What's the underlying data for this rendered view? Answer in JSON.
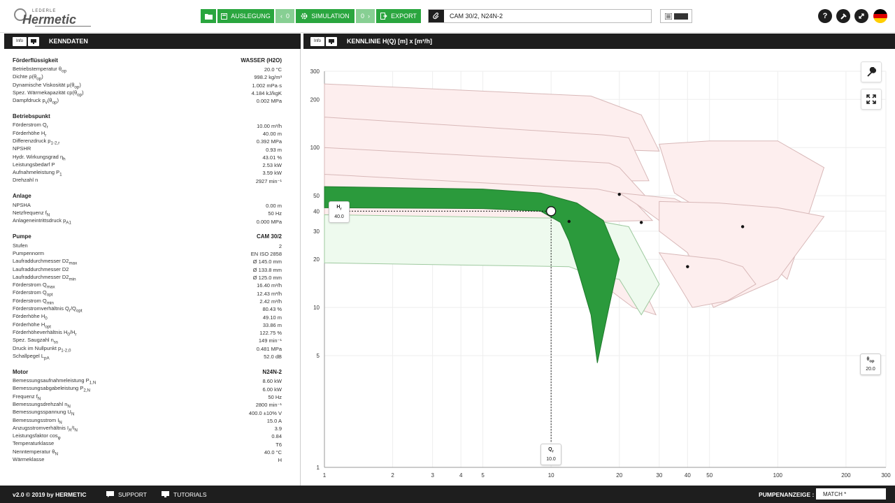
{
  "header": {
    "logo_small": "LEDERLE",
    "logo_big": "Hermetic",
    "folder_icon": "folder-icon",
    "btn_auslegung": "AUSLEGUNG",
    "btn_auslegung_count": "0",
    "btn_simulation": "SIMULATION",
    "btn_simulation_count": "0",
    "btn_export": "EXPORT",
    "project_name": "CAM 30/2, N24N-2",
    "help": "?",
    "flag_colors": [
      "#000000",
      "#dd0000",
      "#ffce00"
    ]
  },
  "left_panel": {
    "chip_info": "Info",
    "title": "KENNDATEN",
    "sections": [
      {
        "title": "Förderflüssigkeit",
        "value": "WASSER (H2O)",
        "rows": [
          [
            "Betriebstemperatur θ",
            "op",
            "20.0 °C"
          ],
          [
            "Dichte ρ(θ",
            "op",
            ")",
            "998.2 kg/m³"
          ],
          [
            "Dynamische Viskosität μ(θ",
            "op",
            ")",
            "1.002 mPa·s"
          ],
          [
            "Spez. Wärmekapazität cp(θ",
            "op",
            ")",
            "4.184 kJ/kgK"
          ],
          [
            "Dampfdruck p",
            "v",
            "(θ",
            "op",
            ")",
            "0.002 MPa"
          ]
        ]
      },
      {
        "title": "Betriebspunkt",
        "value": "",
        "rows": [
          [
            "Förderstrom Q",
            "r",
            "10.00 m³/h"
          ],
          [
            "Förderhöhe H",
            "r",
            "40.00 m"
          ],
          [
            "Differenzdruck p",
            "1-2,r",
            "0.392 MPa"
          ],
          [
            "NPSHR",
            "",
            "0.93 m"
          ],
          [
            "Hydr. Wirkungsgrad η",
            "h",
            "43.01 %"
          ],
          [
            "Leistungsbedarf P",
            "",
            "2.53 kW"
          ],
          [
            "Aufnahmeleistung P",
            "1",
            "3.59 kW"
          ],
          [
            "Drehzahl n",
            "",
            "2927 min⁻¹"
          ]
        ]
      },
      {
        "title": "Anlage",
        "value": "",
        "rows": [
          [
            "NPSHA",
            "",
            "0.00 m"
          ],
          [
            "Netzfrequenz f",
            "N",
            "50 Hz"
          ],
          [
            "Anlageneintrittsdruck p",
            "A1",
            "0.000 MPa"
          ]
        ]
      },
      {
        "title": "Pumpe",
        "value": "CAM 30/2",
        "rows": [
          [
            "Stufen",
            "",
            "2"
          ],
          [
            "Pumpennorm",
            "",
            "EN ISO 2858"
          ],
          [
            "Laufraddurchmesser D2",
            "max",
            "Ø 145.0 mm"
          ],
          [
            "Laufraddurchmesser D2",
            "",
            "Ø 133.8 mm"
          ],
          [
            "Laufraddurchmesser D2",
            "min",
            "Ø 125.0 mm"
          ],
          [
            "Förderstrom Q",
            "max",
            "16.40 m³/h"
          ],
          [
            "Förderstrom Q",
            "opt",
            "12.43 m³/h"
          ],
          [
            "Förderstrom Q",
            "min",
            "2.42 m³/h"
          ],
          [
            "Förderstromverhältnis Q",
            "r",
            "/Q",
            "opt",
            "80.43 %"
          ],
          [
            "Förderhöhe H",
            "0",
            "49.10 m"
          ],
          [
            "Förderhöhe H",
            "opt",
            "33.86 m"
          ],
          [
            "Förderhöheverhältnis H",
            "0",
            "/H",
            "r",
            "122.75 %"
          ],
          [
            "Spez. Saugzahl n",
            "ss",
            "149 min⁻¹"
          ],
          [
            "Druck im Nullpunkt p",
            "1-2,0",
            "0.481 MPa"
          ],
          [
            "Schallpegel L",
            "pA",
            "52.0 dB"
          ]
        ]
      },
      {
        "title": "Motor",
        "value": "N24N-2",
        "rows": [
          [
            "Bemessungsaufnahmeleistung P",
            "1,N",
            "8.60 kW"
          ],
          [
            "Bemessungsabgabeleistung P",
            "2,N",
            "6.00 kW"
          ],
          [
            "Frequenz f",
            "N",
            "50 Hz"
          ],
          [
            "Bemessungsdrehzahl n",
            "N",
            "2800 min⁻¹"
          ],
          [
            "Bemessungsspannung U",
            "N",
            "400.0 ±10% V"
          ],
          [
            "Bemessungsstrom I",
            "N",
            "15.0 A"
          ],
          [
            "Anzugsstromverhältnis I",
            "A",
            "/I",
            "N",
            "3.9"
          ],
          [
            "Leistungsfaktor cos",
            "φ",
            "0.84"
          ],
          [
            "Temperaturklasse",
            "",
            "T6"
          ],
          [
            "Nenntemperatur θ",
            "N",
            "40.0 °C"
          ],
          [
            "Wärmeklasse",
            "",
            "H"
          ]
        ]
      }
    ]
  },
  "chart_panel": {
    "chip_info": "Info",
    "title": "KENNLINIE H(Q) [m] x [m³/h]"
  },
  "chart_data": {
    "type": "area",
    "x_scale": "log",
    "y_scale": "log",
    "xlim": [
      1,
      300
    ],
    "ylim": [
      1,
      300
    ],
    "x_ticks": [
      1,
      2,
      3,
      4,
      5,
      10,
      20,
      30,
      40,
      50,
      100,
      200,
      300
    ],
    "y_ticks": [
      1,
      5,
      10,
      20,
      30,
      40,
      50,
      100,
      200,
      300
    ],
    "operating_point": {
      "x": 10.0,
      "y": 40.0
    },
    "tag_h": {
      "label": "H",
      "sub": "r",
      "value": "40.0"
    },
    "tag_q": {
      "label": "Q",
      "sub": "r",
      "value": "10.0"
    },
    "tag_theta": {
      "label": "θ",
      "sub": "op",
      "value": "20.0"
    },
    "colors": {
      "selected": "#2b9a3c",
      "selected_light": "#eefaee",
      "other": "#fdeeee",
      "other_stroke": "#d8b8b8"
    },
    "other_pumps": [
      {
        "name": "",
        "points": [
          [
            1,
            250
          ],
          [
            15,
            210
          ],
          [
            25,
            160
          ],
          [
            30,
            95
          ],
          [
            1,
            110
          ]
        ]
      },
      {
        "name": "",
        "points": [
          [
            1,
            155
          ],
          [
            17,
            120
          ],
          [
            22,
            115
          ],
          [
            27,
            62
          ],
          [
            1,
            60
          ]
        ]
      },
      {
        "name": "",
        "points": [
          [
            1,
            100
          ],
          [
            18,
            80
          ],
          [
            20,
            75
          ],
          [
            26,
            50
          ],
          [
            1,
            45
          ]
        ]
      },
      {
        "name": "",
        "points": [
          [
            1,
            68
          ],
          [
            16,
            55
          ],
          [
            22,
            50
          ],
          [
            28,
            35
          ],
          [
            1,
            32
          ]
        ]
      },
      {
        "name": "",
        "points": [
          [
            20,
            52
          ],
          [
            35,
            48
          ],
          [
            45,
            40
          ],
          [
            48,
            33
          ],
          [
            30,
            35
          ],
          [
            24,
            44
          ]
        ]
      },
      {
        "name": "",
        "points": [
          [
            30,
            105
          ],
          [
            50,
            110
          ],
          [
            100,
            110
          ],
          [
            160,
            75
          ],
          [
            110,
            15
          ],
          [
            60,
            32
          ],
          [
            35,
            52
          ]
        ]
      },
      {
        "name": "",
        "points": [
          [
            30,
            46
          ],
          [
            55,
            45
          ],
          [
            100,
            42
          ],
          [
            160,
            37
          ],
          [
            100,
            15
          ],
          [
            52,
            10
          ],
          [
            40,
            22
          ],
          [
            30,
            30
          ]
        ]
      },
      {
        "name": "",
        "points": [
          [
            30,
            22
          ],
          [
            55,
            20
          ],
          [
            70,
            18
          ],
          [
            80,
            14
          ],
          [
            60,
            11
          ],
          [
            42,
            10
          ]
        ]
      },
      {
        "name": "",
        "points": [
          [
            12,
            20
          ],
          [
            20,
            18
          ],
          [
            25,
            14
          ],
          [
            29,
            9
          ],
          [
            23,
            10
          ]
        ]
      }
    ],
    "selected_pump_lite": {
      "name": "",
      "points": [
        [
          1,
          38
        ],
        [
          14,
          36
        ],
        [
          22,
          32
        ],
        [
          30,
          14
        ],
        [
          25,
          9
        ],
        [
          20,
          15
        ],
        [
          15,
          16
        ],
        [
          12,
          18
        ],
        [
          1,
          19
        ]
      ]
    },
    "selected_pump_region": {
      "name": "",
      "points": [
        [
          1,
          57
        ],
        [
          5,
          55
        ],
        [
          9,
          52
        ],
        [
          13,
          45
        ],
        [
          17,
          35
        ],
        [
          20,
          20
        ],
        [
          18,
          10
        ],
        [
          16,
          4.5
        ],
        [
          15,
          9
        ],
        [
          13,
          18
        ],
        [
          12,
          26
        ],
        [
          11,
          34
        ],
        [
          9,
          40
        ],
        [
          5,
          41.5
        ],
        [
          1,
          42
        ]
      ]
    },
    "curve_markers": [
      [
        12,
        34.5
      ],
      [
        25,
        34
      ],
      [
        40,
        18
      ],
      [
        70,
        32
      ],
      [
        20,
        51
      ]
    ]
  },
  "footer": {
    "copyright": "v2.0 © 2019 by HERMETIC",
    "support": "SUPPORT",
    "tutorials": "TUTORIALS",
    "pump_display_label": "PUMPENANZEIGE :",
    "pump_display_value": "MATCH *"
  }
}
